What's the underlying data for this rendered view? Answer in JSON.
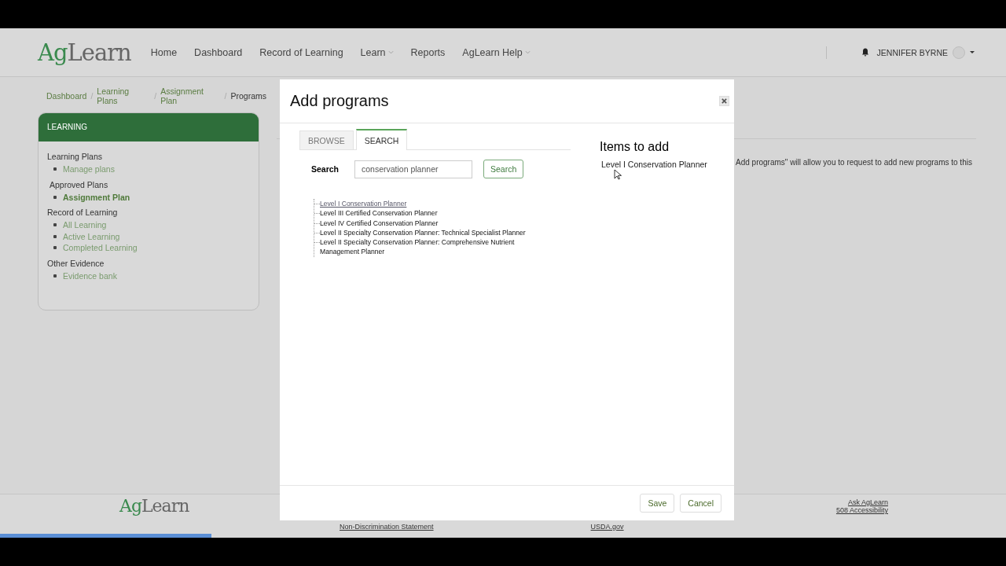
{
  "logo": {
    "prefix": "Ag",
    "rest": "Learn"
  },
  "nav": [
    {
      "label": "Home",
      "dropdown": false
    },
    {
      "label": "Dashboard",
      "dropdown": false
    },
    {
      "label": "Record of Learning",
      "dropdown": false
    },
    {
      "label": "Learn",
      "dropdown": true
    },
    {
      "label": "Reports",
      "dropdown": false
    },
    {
      "label": "AgLearn Help",
      "dropdown": true
    }
  ],
  "user": {
    "name": "JENNIFER BYRNE"
  },
  "breadcrumb": [
    {
      "label": "Dashboard",
      "current": false
    },
    {
      "separator": "/",
      "label": "Learning Plans",
      "current": false
    },
    {
      "separator": "/",
      "label": "Assignment Plan",
      "current": false
    },
    {
      "separator": "/",
      "label": "Programs",
      "current": true
    }
  ],
  "sidebar": {
    "title": "LEARNING",
    "groups": [
      {
        "heading": "Learning Plans",
        "items": [
          {
            "label": "Manage plans",
            "selected": false
          }
        ]
      },
      {
        "heading": "Approved Plans",
        "items": [
          {
            "label": "Assignment Plan",
            "selected": true
          }
        ]
      },
      {
        "heading": "Record of Learning",
        "items": [
          {
            "label": "All Learning",
            "selected": false
          },
          {
            "label": "Active Learning",
            "selected": false
          },
          {
            "label": "Completed Learning",
            "selected": false
          }
        ]
      },
      {
        "heading": "Other Evidence",
        "items": [
          {
            "label": "Evidence bank",
            "selected": false
          }
        ]
      }
    ]
  },
  "content": {
    "note": "Add programs\" will allow you to request to add new programs to this"
  },
  "modal": {
    "title": "Add programs",
    "tabs": [
      {
        "label": "BROWSE",
        "selected": false
      },
      {
        "label": "SEARCH",
        "selected": true
      }
    ],
    "search": {
      "label": "Search",
      "value": "conservation planner",
      "button": "Search"
    },
    "results": [
      {
        "label": "Level I Conservation Planner",
        "selected": true
      },
      {
        "label": "Level III Certified Conservation Planner",
        "selected": false
      },
      {
        "label": "Level IV Certified Conservation Planner",
        "selected": false
      },
      {
        "label": "Level II Specialty Conservation Planner: Technical Specialist Planner",
        "selected": false
      },
      {
        "label": "Level II Specialty Conservation Planner: Comprehensive Nutrient Management Planner",
        "selected": false
      }
    ],
    "items_title": "Items to add",
    "items": [
      "Level I Conservation Planner"
    ],
    "buttons": [
      "Save",
      "Cancel"
    ]
  },
  "footer": {
    "logo": {
      "prefix": "Ag",
      "rest": "Learn"
    },
    "links_middle": [
      "Non-Discrimination Statement",
      "USDA.gov"
    ],
    "links_right": [
      "Ask AgLearn",
      "508 Accessibility"
    ]
  },
  "loading_bar": {
    "level": 0.21
  }
}
